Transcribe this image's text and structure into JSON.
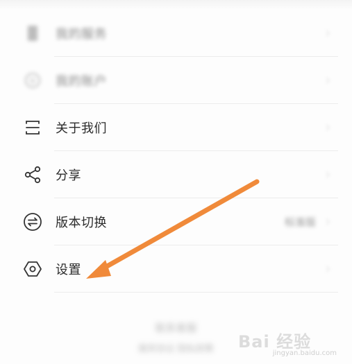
{
  "menu": {
    "items": [
      {
        "name": "blurred-item-1",
        "icon": "document-icon",
        "label": "我的服务",
        "blurred": true
      },
      {
        "name": "blurred-item-2",
        "icon": "yuan-icon",
        "label": "我的账户",
        "blurred": true
      },
      {
        "name": "about-us",
        "icon": "window-icon",
        "label": "关于我们",
        "blurred": false
      },
      {
        "name": "share",
        "icon": "share-icon",
        "label": "分享",
        "blurred": false
      },
      {
        "name": "version-switch",
        "icon": "swap-icon",
        "label": "版本切换",
        "blurred": false,
        "value": "标准版"
      },
      {
        "name": "settings",
        "icon": "settings-icon",
        "label": "设置",
        "blurred": false
      }
    ]
  },
  "footer": {
    "line1": "联系客服",
    "line2": "服务协议  隐私政策"
  },
  "annotation": {
    "arrow_color": "#f08a3a"
  },
  "watermark": {
    "text": "Bai 经验",
    "url": "jingyan.baidu.com"
  }
}
